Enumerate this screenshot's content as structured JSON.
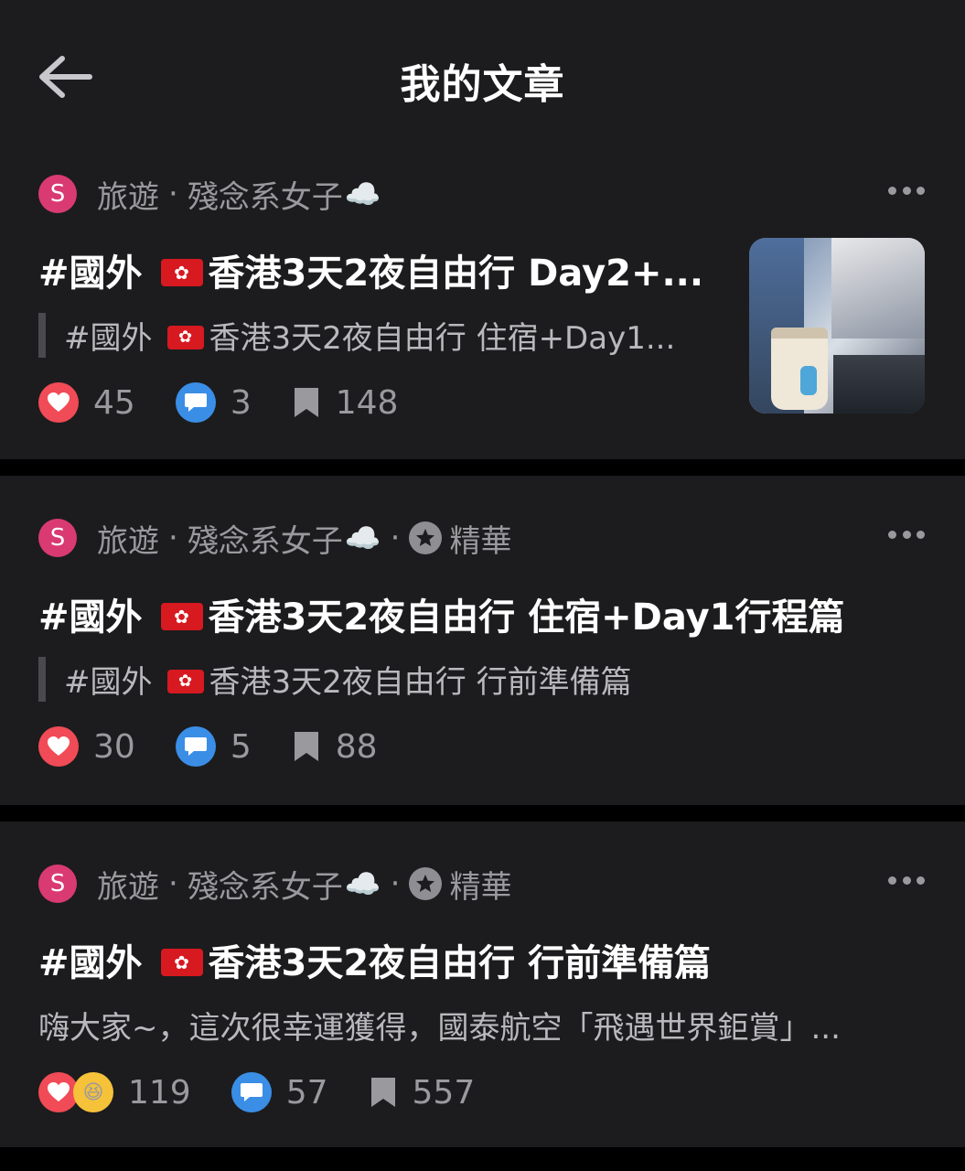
{
  "header": {
    "title": "我的文章"
  },
  "posts": [
    {
      "board": "旅遊",
      "author": "殘念系女子",
      "featured": false,
      "title_prefix": "#國外",
      "title_main": "香港3天2夜自由行 Day2+...",
      "excerpt_prefix": "#國外",
      "excerpt_main": "香港3天2夜自由行 住宿+Day1...",
      "likes": "45",
      "comments": "3",
      "saves": "148",
      "has_thumbnail": true
    },
    {
      "board": "旅遊",
      "author": "殘念系女子",
      "featured": true,
      "featured_label": "精華",
      "title_prefix": "#國外",
      "title_main": "香港3天2夜自由行 住宿+Day1行程篇",
      "excerpt_prefix": "#國外",
      "excerpt_main": "香港3天2夜自由行 行前準備篇",
      "likes": "30",
      "comments": "5",
      "saves": "88"
    },
    {
      "board": "旅遊",
      "author": "殘念系女子",
      "featured": true,
      "featured_label": "精華",
      "title_prefix": "#國外",
      "title_main": "香港3天2夜自由行 行前準備篇",
      "excerpt_plain": "嗨大家~，這次很幸運獲得，國泰航空「飛遇世界鉅賞」...",
      "likes": "119",
      "comments": "57",
      "saves": "557"
    }
  ],
  "avatar_letter": "S",
  "colors": {
    "heart": "#f04b56",
    "comment": "#3a8ee6",
    "avatar": "#d93a72",
    "background": "#1c1c1e"
  },
  "icons": [
    "back-arrow-icon",
    "cloud-emoji-icon",
    "star-icon",
    "more-dots-icon",
    "heart-icon",
    "laugh-reaction-icon",
    "comment-bubble-icon",
    "bookmark-icon",
    "hk-flag-icon"
  ]
}
